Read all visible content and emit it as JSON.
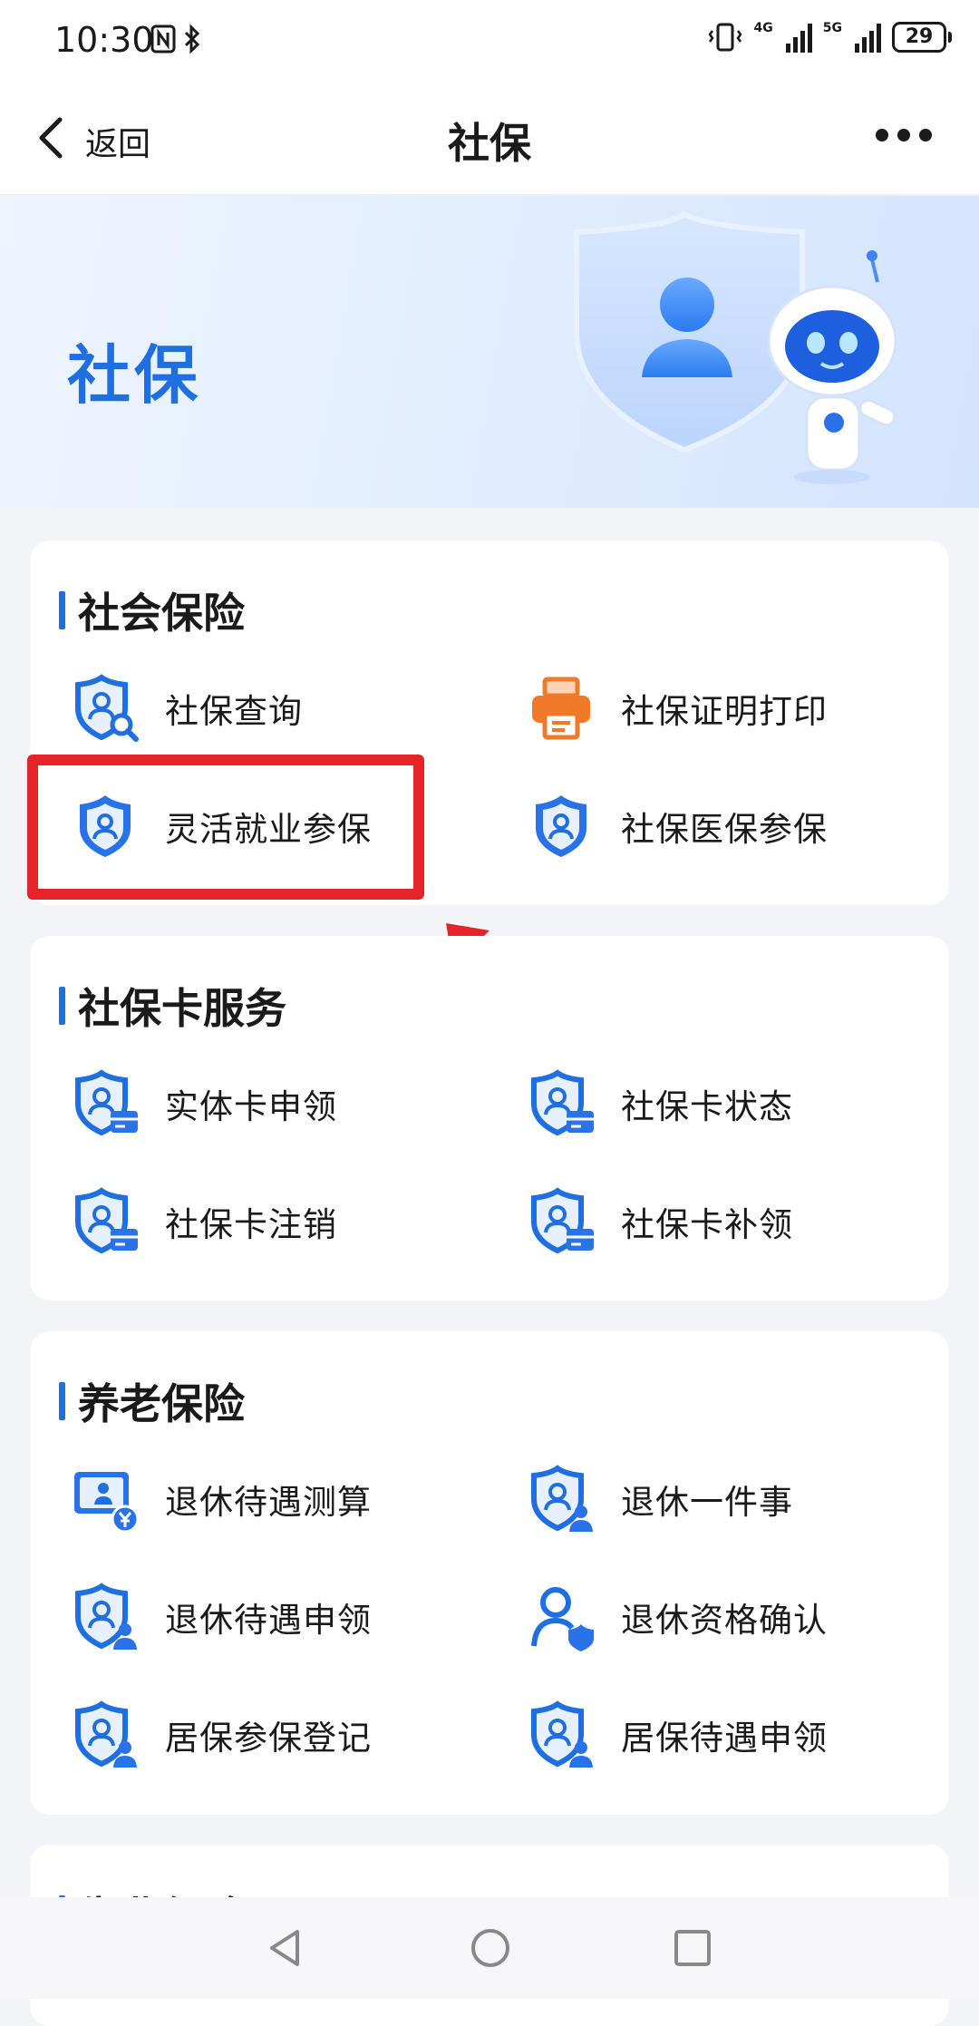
{
  "status_bar": {
    "time": "10:30",
    "network_1": "4G",
    "network_2": "5G",
    "battery": "29"
  },
  "nav": {
    "back_label": "返回",
    "title": "社保"
  },
  "banner": {
    "title": "社保"
  },
  "sections": [
    {
      "title": "社会保险",
      "items": [
        {
          "label": "社保查询",
          "icon": "shield-person-search-icon"
        },
        {
          "label": "社保证明打印",
          "icon": "printer-icon"
        },
        {
          "label": "灵活就业参保",
          "icon": "shield-person-icon"
        },
        {
          "label": "社保医保参保",
          "icon": "shield-person-icon"
        }
      ]
    },
    {
      "title": "社保卡服务",
      "items": [
        {
          "label": "实体卡申领",
          "icon": "shield-person-card-icon"
        },
        {
          "label": "社保卡状态",
          "icon": "shield-person-card-icon"
        },
        {
          "label": "社保卡注销",
          "icon": "shield-person-card-icon"
        },
        {
          "label": "社保卡补领",
          "icon": "shield-person-card-icon"
        }
      ]
    },
    {
      "title": "养老保险",
      "items": [
        {
          "label": "退休待遇测算",
          "icon": "monitor-yuan-icon"
        },
        {
          "label": "退休一件事",
          "icon": "shield-person-user-icon"
        },
        {
          "label": "退休待遇申领",
          "icon": "shield-person-user-icon"
        },
        {
          "label": "退休资格确认",
          "icon": "person-shield-icon"
        },
        {
          "label": "居保参保登记",
          "icon": "shield-person-user-icon"
        },
        {
          "label": "居保待遇申领",
          "icon": "shield-person-user-icon"
        }
      ]
    },
    {
      "title": "失业保险",
      "items": []
    }
  ],
  "colors": {
    "accent": "#1f6fe0",
    "highlight": "#e5242a",
    "printer": "#f07a2a"
  }
}
